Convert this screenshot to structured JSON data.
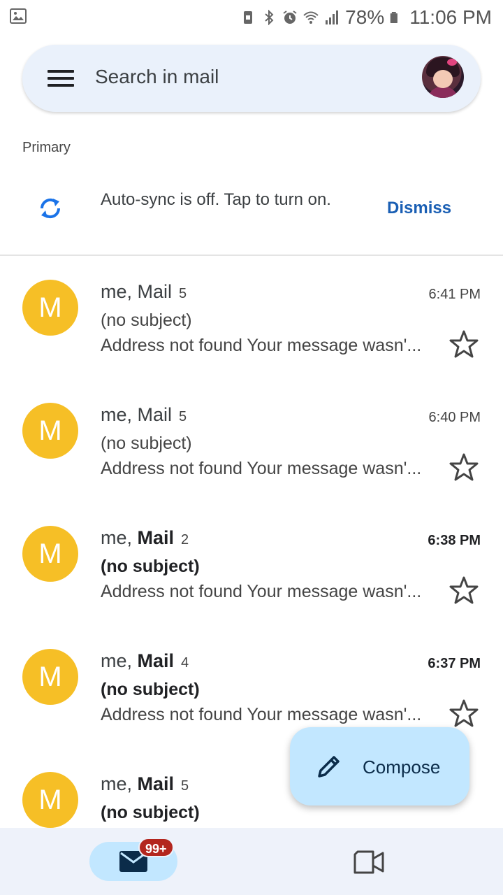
{
  "status_bar": {
    "battery": "78%",
    "time": "11:06 PM",
    "icons": [
      "gallery-icon",
      "screenshot-icon",
      "bluetooth-icon",
      "alarm-icon",
      "wifi-icon",
      "signal-icon",
      "battery-icon"
    ]
  },
  "search": {
    "placeholder": "Search in mail"
  },
  "section": {
    "label": "Primary"
  },
  "sync_banner": {
    "text": "Auto-sync is off. Tap to turn on.",
    "dismiss_label": "Dismiss"
  },
  "emails": [
    {
      "avatar_letter": "M",
      "sender_me": "me, ",
      "sender_other": "Mail",
      "count": "5",
      "time": "6:41 PM",
      "subject": "(no subject)",
      "snippet": "Address not found Your message wasn'...",
      "unread": false
    },
    {
      "avatar_letter": "M",
      "sender_me": "me, ",
      "sender_other": "Mail",
      "count": "5",
      "time": "6:40 PM",
      "subject": "(no subject)",
      "snippet": "Address not found Your message wasn'...",
      "unread": false
    },
    {
      "avatar_letter": "M",
      "sender_me": "me, ",
      "sender_other": "Mail",
      "count": "2",
      "time": "6:38 PM",
      "subject": "(no subject)",
      "snippet": "Address not found Your message wasn'...",
      "unread": true
    },
    {
      "avatar_letter": "M",
      "sender_me": "me, ",
      "sender_other": "Mail",
      "count": "4",
      "time": "6:37 PM",
      "subject": "(no subject)",
      "snippet": "Address not found Your message wasn'...",
      "unread": true
    },
    {
      "avatar_letter": "M",
      "sender_me": "me, ",
      "sender_other": "Mail",
      "count": "5",
      "time": "",
      "subject": "(no subject)",
      "snippet": "",
      "unread": true
    }
  ],
  "compose": {
    "label": "Compose"
  },
  "bottom_nav": {
    "mail_badge": "99+"
  },
  "colors": {
    "accent": "#1a5fb4",
    "avatar_bg": "#f6bf26",
    "fab_bg": "#c2e7ff",
    "badge_bg": "#b3261e"
  }
}
